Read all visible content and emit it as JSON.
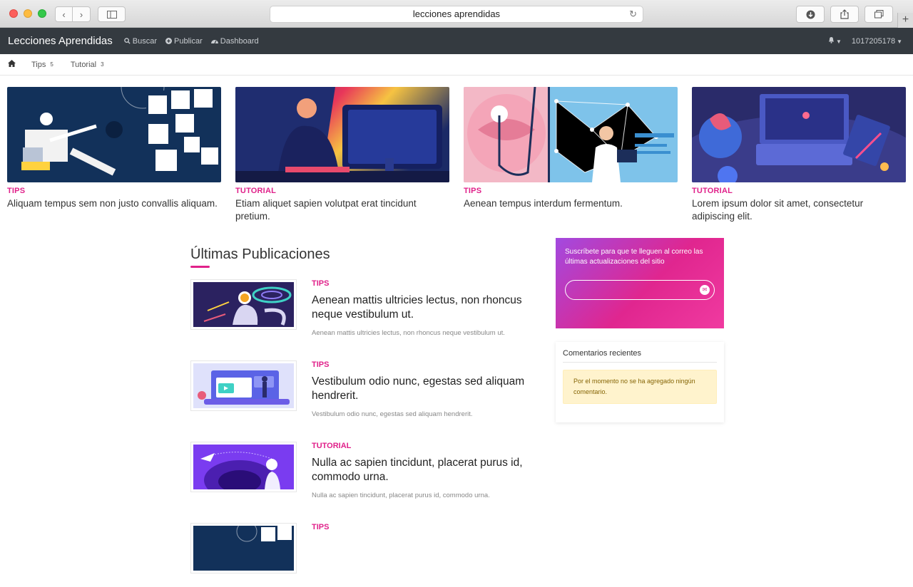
{
  "browser": {
    "url": "lecciones aprendidas"
  },
  "navbar": {
    "brand": "Lecciones Aprendidas",
    "links": [
      {
        "icon": "search-icon",
        "label": "Buscar"
      },
      {
        "icon": "plus-circle-icon",
        "label": "Publicar"
      },
      {
        "icon": "dashboard-icon",
        "label": "Dashboard"
      }
    ],
    "user": "1017205178"
  },
  "categories": [
    {
      "label": "Tips",
      "count": "5"
    },
    {
      "label": "Tutorial",
      "count": "3"
    }
  ],
  "featured": [
    {
      "category": "TIPS",
      "title": "Aliquam tempus sem non justo convallis aliquam."
    },
    {
      "category": "TUTORIAL",
      "title": "Etiam aliquet sapien volutpat erat tincidunt pretium."
    },
    {
      "category": "TIPS",
      "title": "Aenean tempus interdum fermentum."
    },
    {
      "category": "TUTORIAL",
      "title": "Lorem ipsum dolor sit amet, consectetur adipiscing elit."
    }
  ],
  "main": {
    "heading": "Últimas Publicaciones",
    "posts": [
      {
        "category": "TIPS",
        "title": "Aenean mattis ultricies lectus, non rhoncus neque vestibulum ut.",
        "excerpt": "Aenean mattis ultricies lectus, non rhoncus neque vestibulum ut."
      },
      {
        "category": "TIPS",
        "title": "Vestibulum odio nunc, egestas sed aliquam hendrerit.",
        "excerpt": "Vestibulum odio nunc, egestas sed aliquam hendrerit."
      },
      {
        "category": "TUTORIAL",
        "title": "Nulla ac sapien tincidunt, placerat purus id, commodo urna.",
        "excerpt": "Nulla ac sapien tincidunt, placerat purus id, commodo urna."
      },
      {
        "category": "TIPS",
        "title": "",
        "excerpt": ""
      }
    ]
  },
  "sidebar": {
    "subscribe_text": "Suscríbete para que te lleguen al correo las últimas actualizaciones del sitio",
    "subscribe_placeholder": "",
    "comments_title": "Comentarios recientes",
    "comments_empty": "Por el momento no se ha agregado ningún comentario."
  },
  "colors": {
    "accent": "#e0218a",
    "navbar": "#343a40"
  }
}
